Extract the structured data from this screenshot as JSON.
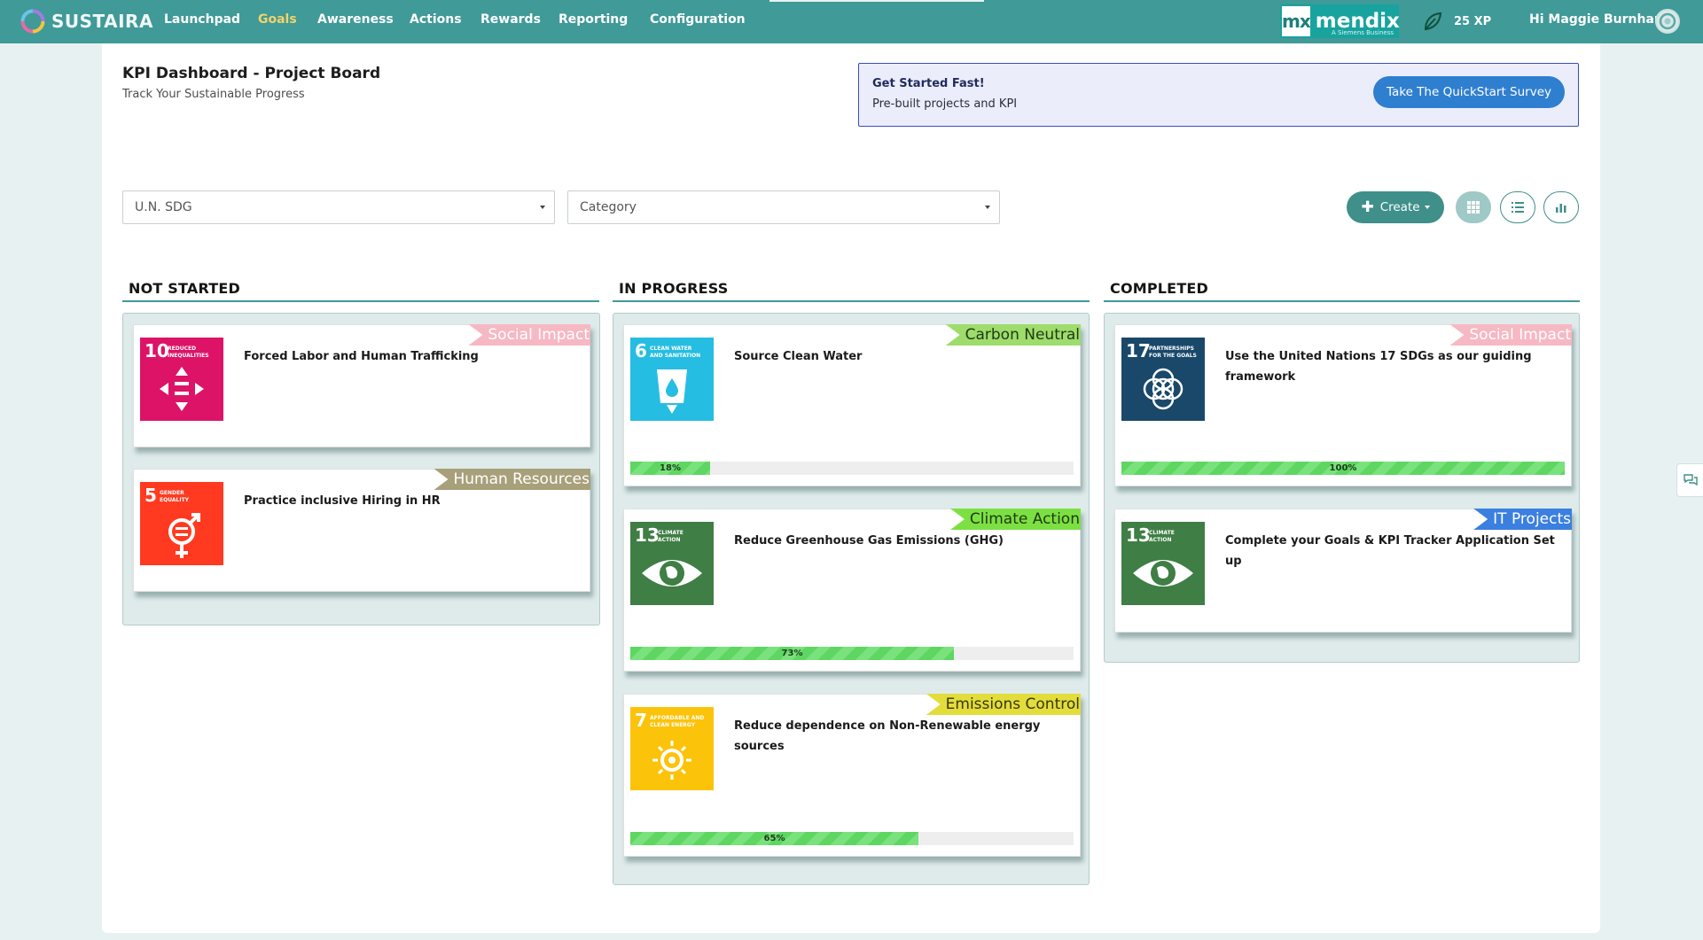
{
  "nav": {
    "brand": "SUSTAIRA",
    "items": [
      {
        "label": "Launchpad"
      },
      {
        "label": "Goals"
      },
      {
        "label": "Awareness"
      },
      {
        "label": "Actions"
      },
      {
        "label": "Rewards"
      },
      {
        "label": "Reporting"
      },
      {
        "label": "Configuration"
      }
    ],
    "active_item": "Goals",
    "mendix": {
      "mx": "mx",
      "name": "mendix",
      "tagline": "A Siemens Business"
    },
    "xp": "25 XP",
    "greeting": "Hi Maggie Burnham"
  },
  "page": {
    "title": "KPI Dashboard - Project Board",
    "subtitle": "Track Your Sustainable Progress"
  },
  "quickstart": {
    "title": "Get Started Fast!",
    "subtitle": "Pre-built projects and KPI",
    "button": "Take The QuickStart Survey"
  },
  "filters": {
    "sdg_placeholder": "U.N. SDG",
    "category_placeholder": "Category"
  },
  "toolbar": {
    "create_label": "Create",
    "views": [
      "grid-view",
      "list-view",
      "chart-view"
    ],
    "active_view": "grid-view"
  },
  "columns": [
    {
      "title": "NOT STARTED",
      "cards": [
        {
          "title": "Forced Labor and Human Trafficking",
          "tag": "Social Impact",
          "tag_bg": "#f6b8c2",
          "tag_fg": "#ffffff",
          "sdg": {
            "number": "10",
            "label1": "REDUCED",
            "label2": "INEQUALITIES",
            "color": "#dd1367",
            "icon": "reduced-inequalities-icon"
          },
          "progress": null
        },
        {
          "title": "Practice inclusive Hiring in HR",
          "tag": "Human Resources",
          "tag_bg": "#a8a07a",
          "tag_fg": "#ffffff",
          "sdg": {
            "number": "5",
            "label1": "GENDER",
            "label2": "EQUALITY",
            "color": "#ff3a21",
            "icon": "gender-equality-icon"
          },
          "progress": null
        }
      ]
    },
    {
      "title": "IN PROGRESS",
      "cards": [
        {
          "title": "Source Clean Water",
          "tag": "Carbon Neutral",
          "tag_bg": "#9edc6c",
          "tag_fg": "#1f3a12",
          "sdg": {
            "number": "6",
            "label1": "CLEAN WATER",
            "label2": "AND SANITATION",
            "color": "#26bde2",
            "icon": "clean-water-icon"
          },
          "progress": 18,
          "progress_label": "18%"
        },
        {
          "title": "Reduce Greenhouse Gas Emissions (GHG)",
          "tag": "Climate Action",
          "tag_bg": "#7ce043",
          "tag_fg": "#1f3a12",
          "sdg": {
            "number": "13",
            "label1": "CLIMATE",
            "label2": "ACTION",
            "color": "#3f7e44",
            "icon": "climate-action-icon"
          },
          "progress": 73,
          "progress_label": "73%"
        },
        {
          "title": "Reduce dependence on Non-Renewable energy sources",
          "tag": "Emissions Control",
          "tag_bg": "#e2dd3a",
          "tag_fg": "#3a3610",
          "sdg": {
            "number": "7",
            "label1": "AFFORDABLE AND",
            "label2": "CLEAN ENERGY",
            "color": "#fcc30b",
            "icon": "clean-energy-icon"
          },
          "progress": 65,
          "progress_label": "65%"
        }
      ]
    },
    {
      "title": "COMPLETED",
      "cards": [
        {
          "title": "Use the United Nations 17 SDGs as our guiding framework",
          "tag": "Social Impact",
          "tag_bg": "#f6b8c2",
          "tag_fg": "#ffffff",
          "sdg": {
            "number": "17",
            "label1": "PARTNERSHIPS",
            "label2": "FOR THE GOALS",
            "color": "#19486a",
            "icon": "partnerships-icon"
          },
          "progress": 100,
          "progress_label": "100%"
        },
        {
          "title": "Complete your Goals & KPI Tracker Application Set up",
          "tag": "IT Projects",
          "tag_bg": "#3b7fe0",
          "tag_fg": "#ffffff",
          "sdg": {
            "number": "13",
            "label1": "CLIMATE",
            "label2": "ACTION",
            "color": "#3f7e44",
            "icon": "climate-action-icon"
          },
          "progress": null
        }
      ]
    }
  ],
  "colors": {
    "nav_bg": "#3f9a98",
    "accent": "#3f8f8a",
    "active_nav": "#f3d36b",
    "progress": "#5ed661"
  }
}
